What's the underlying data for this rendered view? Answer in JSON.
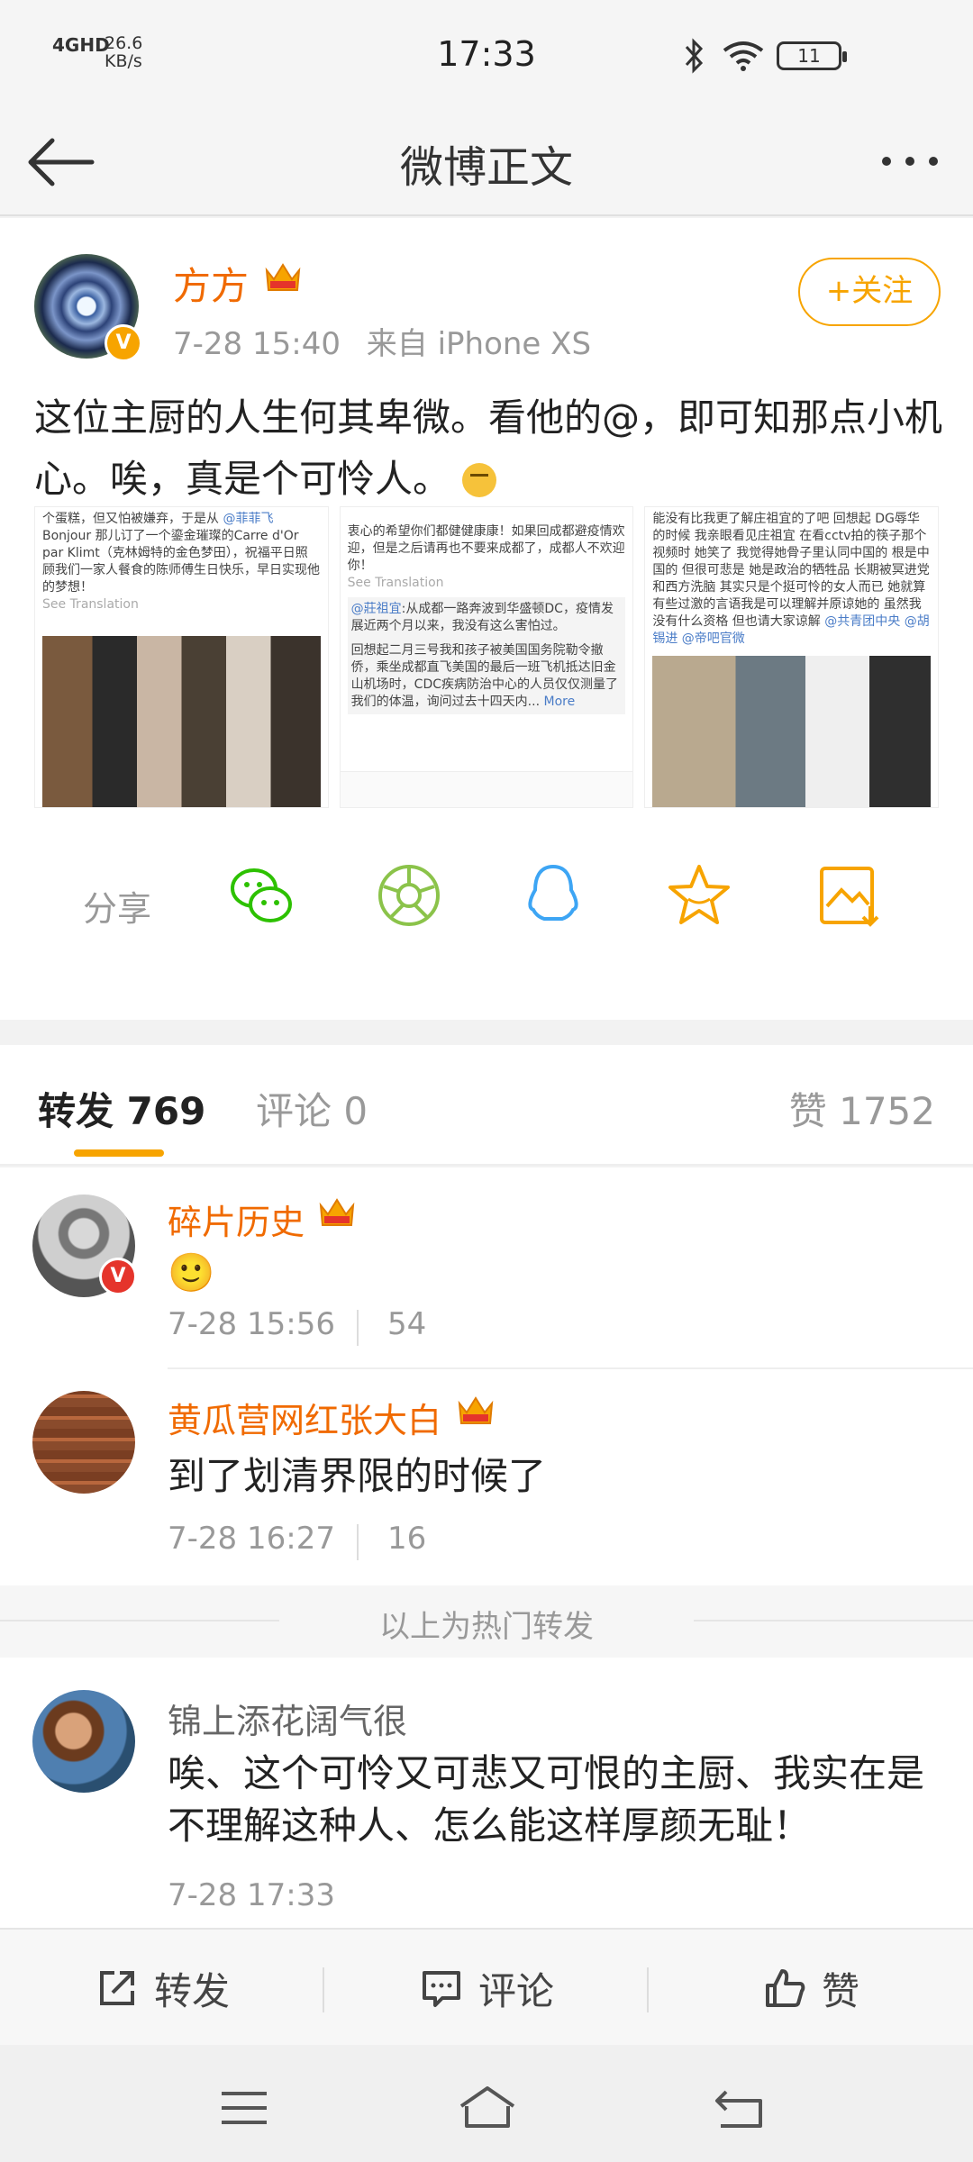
{
  "status_bar": {
    "network": "4GHD",
    "speed_value": "26.6",
    "speed_unit": "KB/s",
    "time": "17:33",
    "battery": "11"
  },
  "nav": {
    "title": "微博正文"
  },
  "post": {
    "author": "方方",
    "time": "7-28 15:40",
    "source": "来自 iPhone XS",
    "follow_label": "+关注",
    "text": "这位主厨的人生何其卑微。看他的@，即可知那点小机心。唉，真是个可怜人。",
    "images": [
      {
        "text_before": "个蛋糕，但又怕被嫌弃，于是从",
        "mention": "@菲菲飞",
        "text_mid": "Bonjour 那儿订了一个鎏金璀璨的Carre d'Or par Klimt（克林姆特的金色梦田），祝福平日照顾我们一家人餐食的陈师傅生日快乐，早日实现他的梦想！",
        "translate": "See Translation"
      },
      {
        "text_top": "衷心的希望你们都健健康康！如果回成都避疫情欢迎，但是之后请再也不要来成都了，成都人不欢迎你！",
        "translate": "See Translation",
        "mention": "@莊祖宜",
        "text_quote": ":从成都一路奔波到华盛顿DC，疫情发展近两个月以来，我没有这么害怕过。",
        "text_body": "回想起二月三号我和孩子被美国国务院勒令撤侨，乘坐成都直飞美国的最后一班飞机抵达旧金山机场时，CDC疾病防治中心的人员仅仅测量了我们的体温，询问过去十四天内...",
        "more": "More"
      },
      {
        "text_before": "能没有比我更了解庄祖宜的了吧 回想起 DG辱华的时候 我亲眼看见庄祖宜 在看cctv拍的筷子那个视频时 她笑了 我觉得她骨子里认同中国的 根是中国的 但很可悲是 她是政治的牺牲品 长期被冥进党 和西方洗脑 其实只是个挺可怜的女人而已 她就算有些过激的言语我是可以理解并原谅她的 虽然我没有什么资格 但也请大家谅解",
        "mentions": "@共青团中央 @胡锡进 @帝吧官微"
      }
    ]
  },
  "share": {
    "label": "分享",
    "icons": [
      "wechat-icon",
      "moments-icon",
      "qq-icon",
      "favorite-icon",
      "save-image-icon"
    ]
  },
  "tabs": {
    "repost": "转发 769",
    "comment": "评论 0",
    "like": "赞 1752"
  },
  "reposts": [
    {
      "name": "碎片历史",
      "text": "🙂",
      "time": "7-28 15:56",
      "count": "54"
    },
    {
      "name": "黄瓜营网红张大白",
      "text": "到了划清界限的时候了",
      "time": "7-28 16:27",
      "count": "16"
    }
  ],
  "hot_divider": "以上为热门转发",
  "latest": [
    {
      "name": "锦上添花阔气很",
      "text": "唉、这个可怜又可悲又可恨的主厨、我实在是不理解这种人、怎么能这样厚颜无耻！",
      "time": "7-28 17:33"
    }
  ],
  "actions": {
    "repost": "转发",
    "comment": "评论",
    "like": "赞"
  },
  "colors": {
    "accent": "#f7a400",
    "name_orange": "#f06a00",
    "wechat_green": "#2dc100",
    "qq_blue": "#3da5f4"
  }
}
